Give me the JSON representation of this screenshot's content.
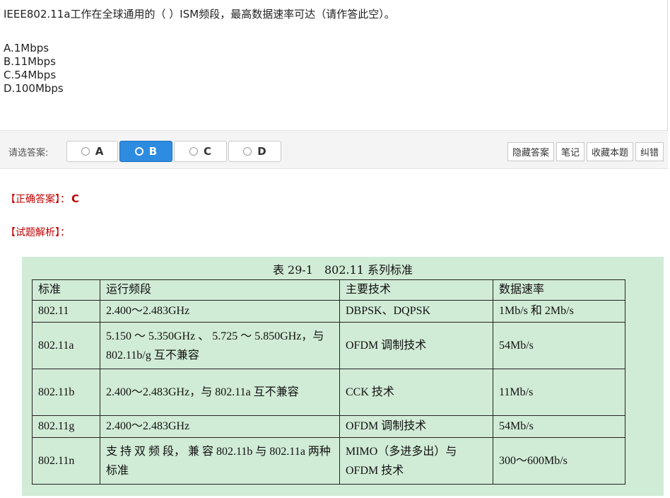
{
  "question": {
    "text": "IEEE802.11a工作在全球通用的（ ）ISM频段，最高数据速率可达（请作答此空）。",
    "options": [
      "A.1Mbps",
      "B.11Mbps",
      "C.54Mbps",
      "D.100Mbps"
    ]
  },
  "answer_bar": {
    "label": "请选答案:",
    "choices": [
      "A",
      "B",
      "C",
      "D"
    ],
    "selected": "B",
    "selected_color": "#2d8be0",
    "tools": [
      "隐藏答案",
      "笔记",
      "收藏本题",
      "纠错"
    ]
  },
  "result": {
    "correct_label": "【正确答案】：",
    "correct_value": "C",
    "analysis_label": "【试题解析】：",
    "label_color": "#c00000"
  },
  "table": {
    "caption": "表 29-1　802.11 系列标准",
    "background": "#d1ecd6",
    "headers": [
      "标准",
      "运行频段",
      "主要技术",
      "数据速率"
    ],
    "rows": [
      [
        "802.11",
        "2.400～2.483GHz",
        "DBPSK、DQPSK",
        "1Mb/s 和 2Mb/s"
      ],
      [
        "802.11a",
        "5.150 ～ 5.350GHz 、 5.725 ～ 5.850GHz，与 802.11b/g 互不兼容",
        "OFDM 调制技术",
        "54Mb/s"
      ],
      [
        "802.11b",
        "2.400～2.483GHz，与 802.11a 互不兼容",
        "CCK 技术",
        "11Mb/s"
      ],
      [
        "802.11g",
        "2.400～2.483GHz",
        "OFDM 调制技术",
        "54Mb/s"
      ],
      [
        "802.11n",
        "支 持 双 频 段， 兼 容 802.11b 与 802.11a 两种标准",
        "MIMO（多进多出）与 OFDM 技术",
        "300～600Mb/s"
      ]
    ]
  }
}
